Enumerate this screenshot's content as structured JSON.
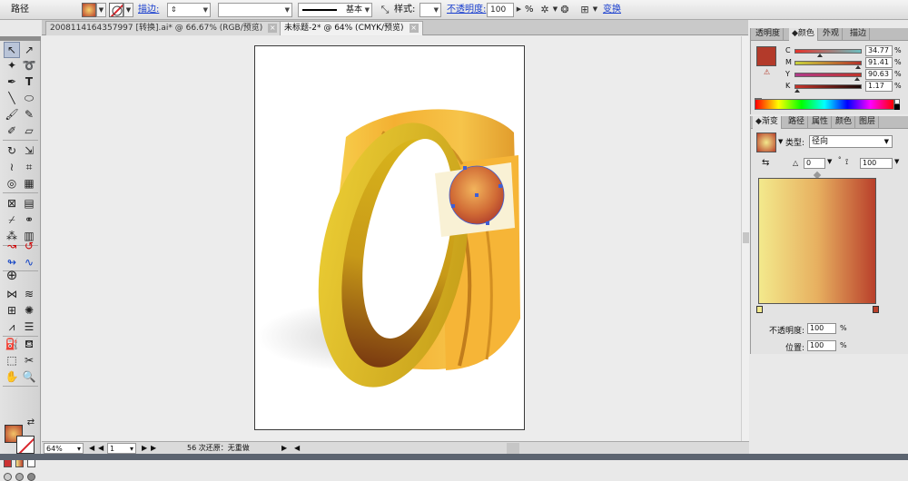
{
  "control_bar": {
    "object_label": "路径",
    "stroke_label": "描边:",
    "stroke_weight_value": "",
    "brush_value": "",
    "stroke_profile_label": "基本",
    "style_label": "样式:",
    "opacity_label": "不透明度:",
    "opacity_value": "100",
    "opacity_unit": "%",
    "transform_label": "变换"
  },
  "document_tabs": [
    {
      "label": "2008114164357997 [转换].ai* @ 66.67% (RGB/预览)",
      "close": "×"
    },
    {
      "label": "未标题-2* @ 64% (CMYK/预览)",
      "close": "×"
    }
  ],
  "status_bar": {
    "zoom": "64%",
    "artboard_number": "1",
    "history": "56 次还原：无重做"
  },
  "color_panel": {
    "tabs": [
      "透明度",
      "颜色",
      "外观",
      "描边"
    ],
    "active_tab": 1,
    "channels": [
      {
        "label": "C",
        "value": "34.77"
      },
      {
        "label": "M",
        "value": "91.41"
      },
      {
        "label": "Y",
        "value": "90.63"
      },
      {
        "label": "K",
        "value": "1.17"
      }
    ],
    "unit": "%",
    "current_color": "#b33a2a"
  },
  "gradient_panel": {
    "tabs": [
      "渐变",
      "路径",
      "属性",
      "颜色",
      "图层"
    ],
    "active_tab": 0,
    "type_label": "类型:",
    "type_value": "径向",
    "angle_value": "0",
    "aspect_value": "100",
    "opacity_label": "不透明度:",
    "opacity_value": "100",
    "location_label": "位置:",
    "location_value": "100",
    "unit": "%",
    "stops": [
      "#f3e98c",
      "#b9402b"
    ]
  }
}
